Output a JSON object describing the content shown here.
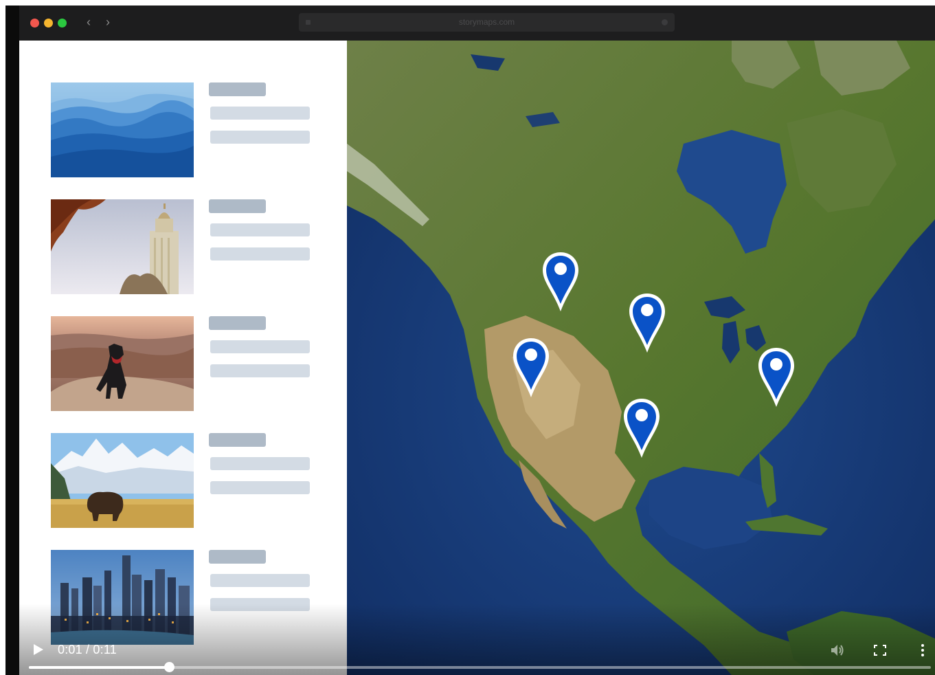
{
  "browser": {
    "url": "storymaps.com",
    "back_icon": "chevron-left-icon",
    "forward_icon": "chevron-right-icon"
  },
  "colors": {
    "close": "#f2574e",
    "minimize": "#f5b52f",
    "maximize": "#2bc840",
    "pin": "#0a52c7",
    "ocean": "#1a3a78",
    "land": "#5a7a38",
    "desert": "#b79f70"
  },
  "story_cards": [
    {
      "image": "blue mountain ridges"
    },
    {
      "image": "capitol building tower"
    },
    {
      "image": "dog on canyon rock"
    },
    {
      "image": "bison below snowy mountains"
    },
    {
      "image": "city skyline at dusk"
    }
  ],
  "map": {
    "pins": [
      {
        "name": "map-pin-1"
      },
      {
        "name": "map-pin-2"
      },
      {
        "name": "map-pin-3"
      },
      {
        "name": "map-pin-4"
      },
      {
        "name": "map-pin-5"
      }
    ]
  },
  "video": {
    "current_time": "0:01",
    "duration": "0:11",
    "timecode": "0:01 / 0:11",
    "progress": 0.155,
    "play_icon": "play-icon",
    "volume_icon": "volume-icon",
    "fullscreen_icon": "fullscreen-icon",
    "more_icon": "more-vertical-icon"
  }
}
